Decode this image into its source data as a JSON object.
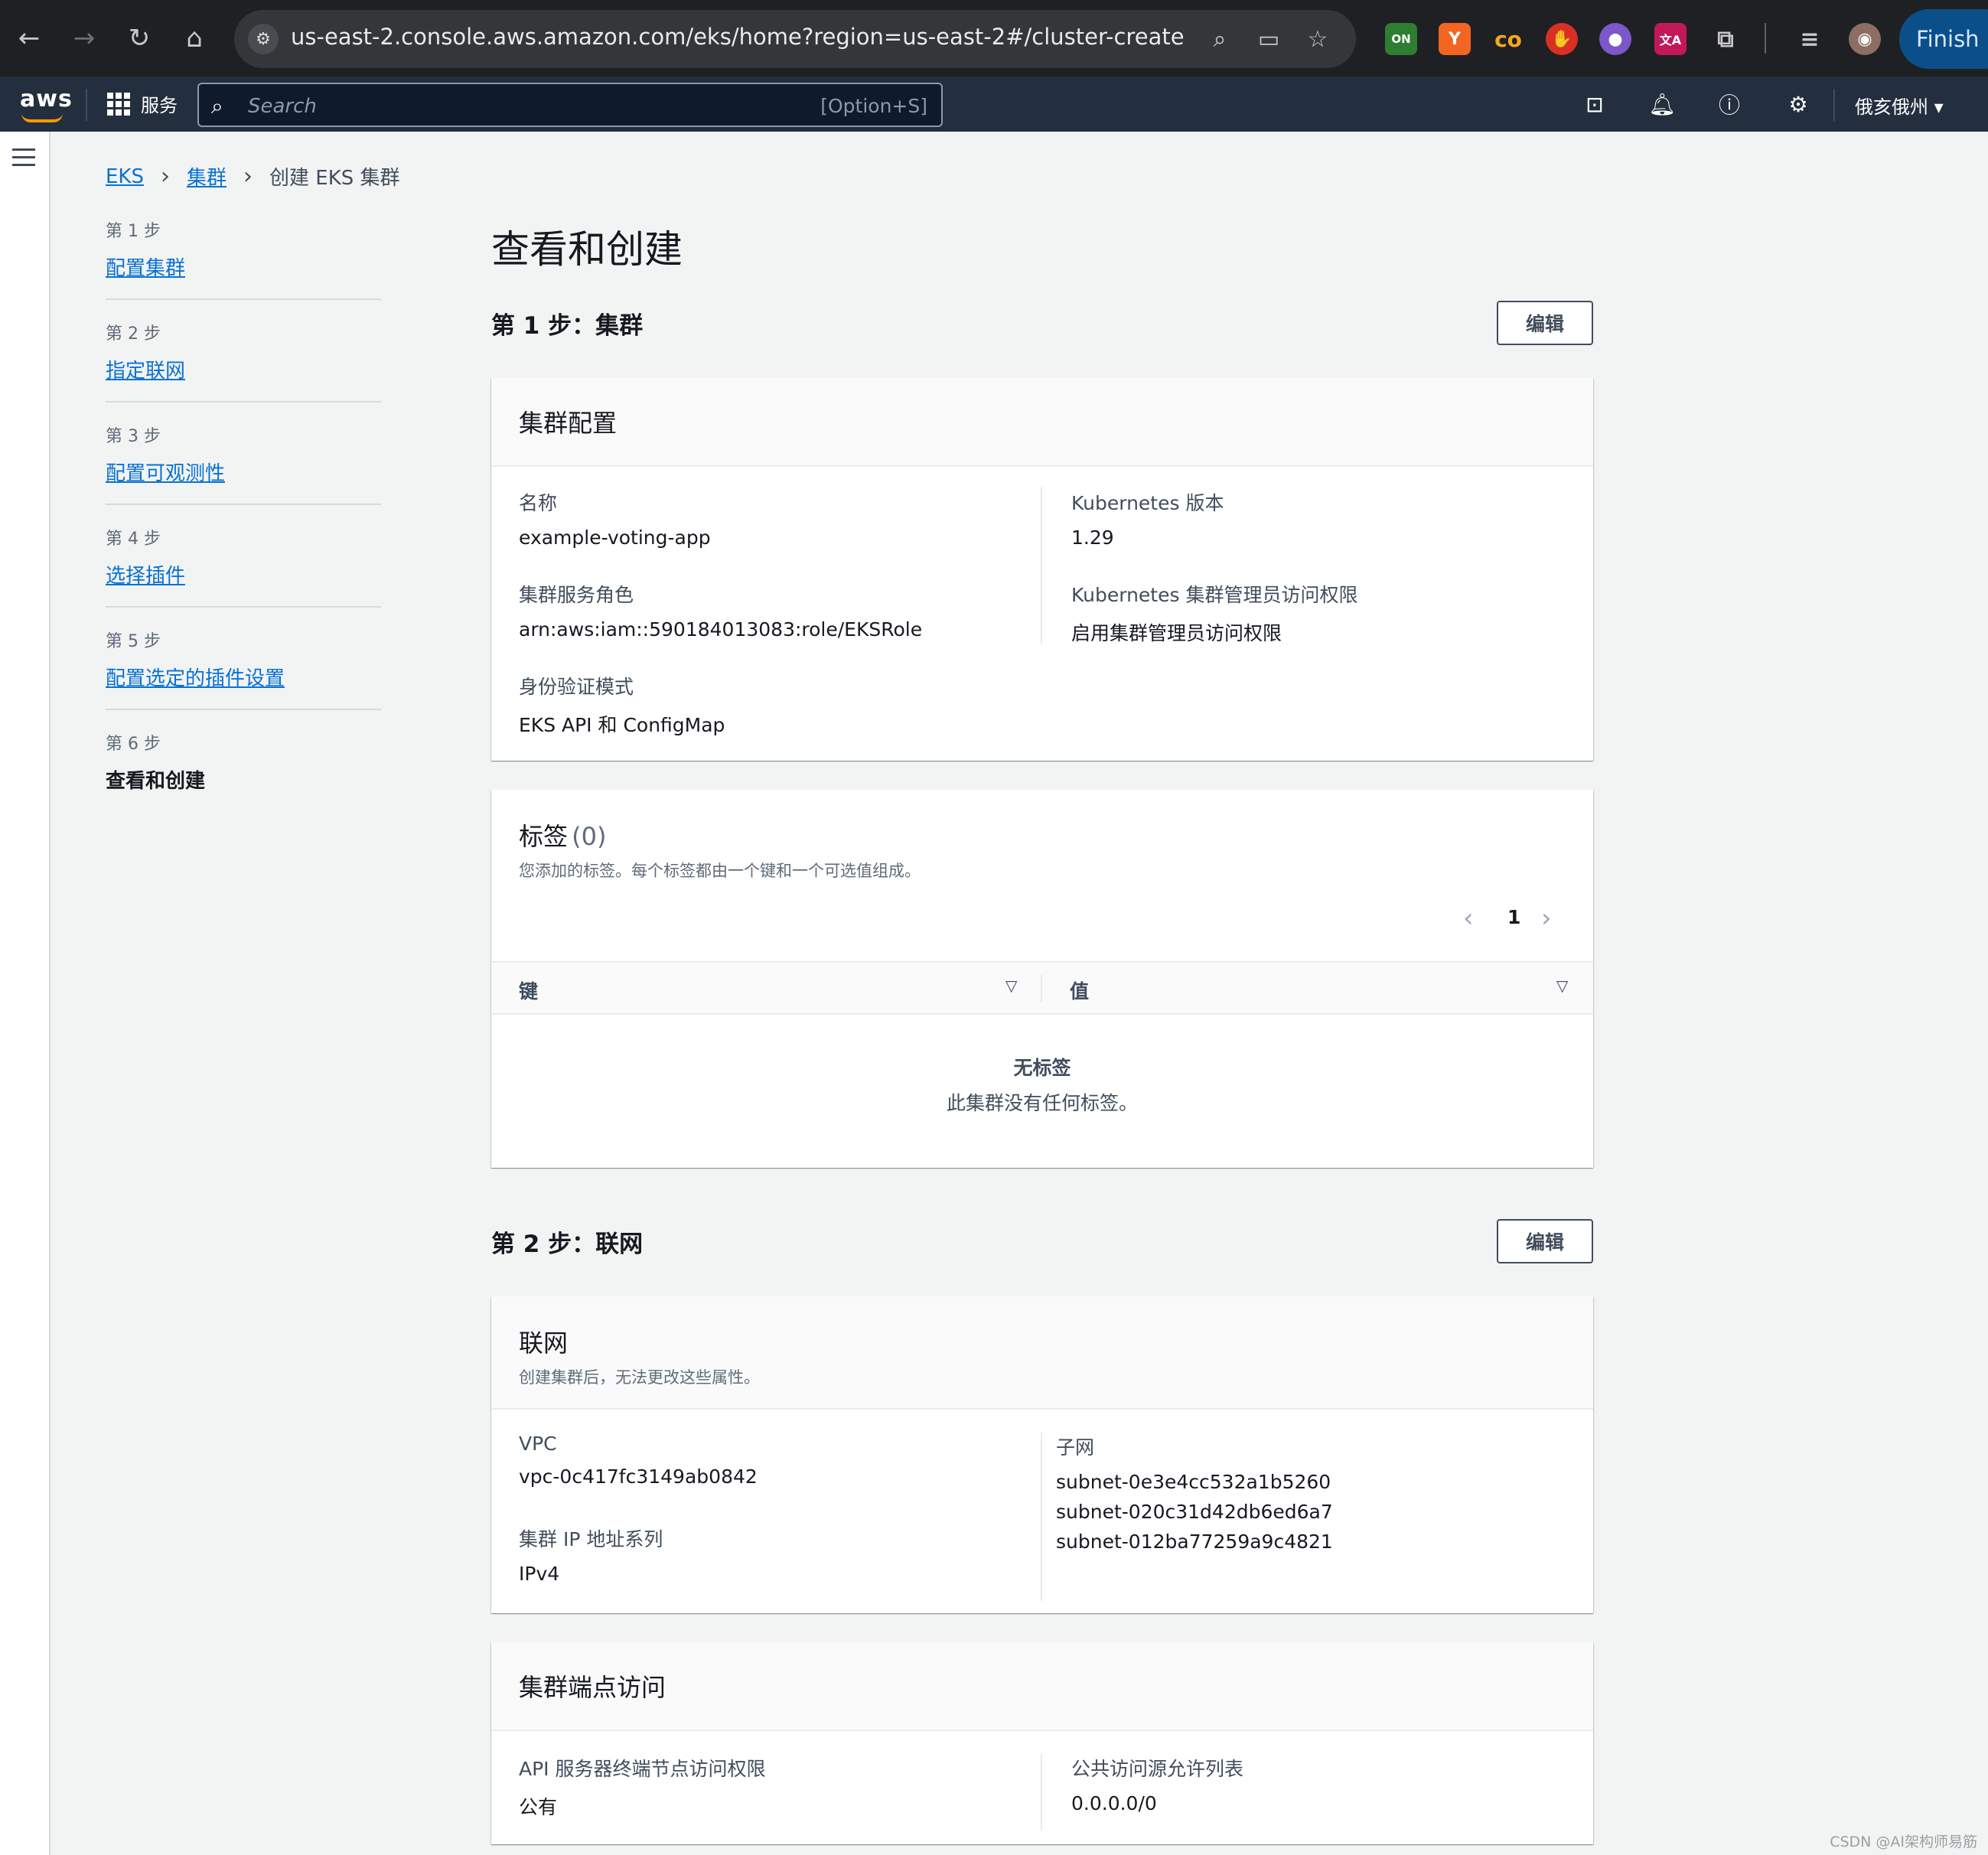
{
  "browser": {
    "url": "us-east-2.console.aws.amazon.com/eks/home?region=us-east-2#/cluster-create",
    "finish_label": "Finish u",
    "ext_on_label": "ON",
    "ext_y_label": "Y",
    "ext_co_label": "co",
    "ext_translate_label": "文A"
  },
  "aws_header": {
    "logo": "aws",
    "services_label": "服务",
    "search_placeholder": "Search",
    "search_shortcut": "[Option+S]",
    "region_label": "俄亥俄州"
  },
  "breadcrumb": {
    "items": [
      "EKS",
      "集群"
    ],
    "current": "创建 EKS 集群"
  },
  "steps": [
    {
      "num": "第 1 步",
      "label": "配置集群"
    },
    {
      "num": "第 2 步",
      "label": "指定联网"
    },
    {
      "num": "第 3 步",
      "label": "配置可观测性"
    },
    {
      "num": "第 4 步",
      "label": "选择插件"
    },
    {
      "num": "第 5 步",
      "label": "配置选定的插件设置"
    },
    {
      "num": "第 6 步",
      "label": "查看和创建"
    }
  ],
  "page_title": "查看和创建",
  "edit_label": "编辑",
  "step1": {
    "title": "第 1 步：集群",
    "cluster_config": {
      "title": "集群配置",
      "name_label": "名称",
      "name_value": "example-voting-app",
      "role_label": "集群服务角色",
      "role_value": "arn:aws:iam::590184013083:role/EKSRole",
      "auth_label": "身份验证模式",
      "auth_value": "EKS API 和 ConfigMap",
      "version_label": "Kubernetes 版本",
      "version_value": "1.29",
      "admin_label": "Kubernetes 集群管理员访问权限",
      "admin_value": "启用集群管理员访问权限"
    },
    "tags": {
      "title": "标签",
      "count": "(0)",
      "desc": "您添加的标签。每个标签都由一个键和一个可选值组成。",
      "page": "1",
      "col_key": "键",
      "col_value": "值",
      "empty_title": "无标签",
      "empty_desc": "此集群没有任何标签。"
    }
  },
  "step2": {
    "title": "第 2 步：联网",
    "networking": {
      "title": "联网",
      "desc": "创建集群后，无法更改这些属性。",
      "vpc_label": "VPC",
      "vpc_value": "vpc-0c417fc3149ab0842",
      "ipfamily_label": "集群 IP 地址系列",
      "ipfamily_value": "IPv4",
      "subnet_label": "子网",
      "subnets": [
        "subnet-0e3e4cc532a1b5260",
        "subnet-020c31d42db6ed6a7",
        "subnet-012ba77259a9c4821"
      ]
    },
    "endpoint": {
      "title": "集群端点访问",
      "api_label": "API 服务器终端节点访问权限",
      "api_value": "公有",
      "allow_label": "公共访问源允许列表",
      "allow_value": "0.0.0.0/0"
    }
  },
  "watermark": "CSDN @AI架构师易筋"
}
